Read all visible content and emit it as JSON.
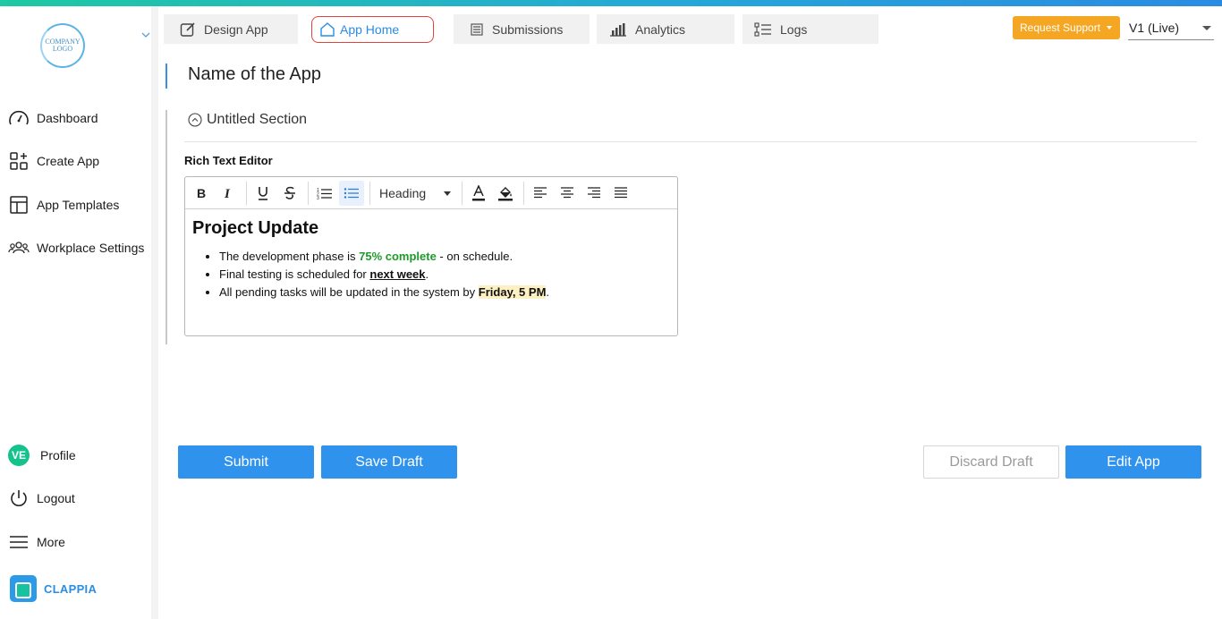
{
  "sidebar": {
    "logo_text": "COMPANY LOGO",
    "nav": [
      {
        "label": "Dashboard",
        "icon": "speedometer-icon"
      },
      {
        "label": "Create App",
        "icon": "grid-plus-icon"
      },
      {
        "label": "App Templates",
        "icon": "templates-icon"
      },
      {
        "label": "Workplace Settings",
        "icon": "users-icon"
      }
    ],
    "profile": {
      "initials": "VE",
      "label": "Profile"
    },
    "logout_label": "Logout",
    "more_label": "More",
    "brand_name": "CLAPPIA"
  },
  "tabs": [
    {
      "label": "Design App",
      "icon": "edit-icon"
    },
    {
      "label": "App Home",
      "icon": "home-icon",
      "active": true
    },
    {
      "label": "Submissions",
      "icon": "list-icon"
    },
    {
      "label": "Analytics",
      "icon": "bar-chart-icon"
    },
    {
      "label": "Logs",
      "icon": "logs-icon"
    }
  ],
  "header": {
    "request_support_label": "Request Support",
    "version_label": "V1 (Live)"
  },
  "main": {
    "app_title": "Name of the App",
    "section_title": "Untitled Section",
    "rte_label": "Rich Text Editor",
    "toolbar": {
      "heading_select": "Heading"
    },
    "editor_content": {
      "heading": "Project Update",
      "bullets": [
        {
          "pre": "The development phase is ",
          "em": "75% complete",
          "post": " - on schedule."
        },
        {
          "pre": "Final testing is scheduled for ",
          "em": "next week",
          "post": "."
        },
        {
          "pre": "All pending tasks will be updated in the system by ",
          "em": "Friday, 5 PM",
          "post": "."
        }
      ]
    },
    "buttons": {
      "submit": "Submit",
      "save_draft": "Save Draft",
      "discard_draft": "Discard Draft",
      "edit_app": "Edit App"
    }
  },
  "colors": {
    "accent": "#2f93ee",
    "support": "#f5a623",
    "active_tab_border": "#e0443e",
    "green_text": "#1e9a2a",
    "highlight": "#fdf1c4"
  }
}
